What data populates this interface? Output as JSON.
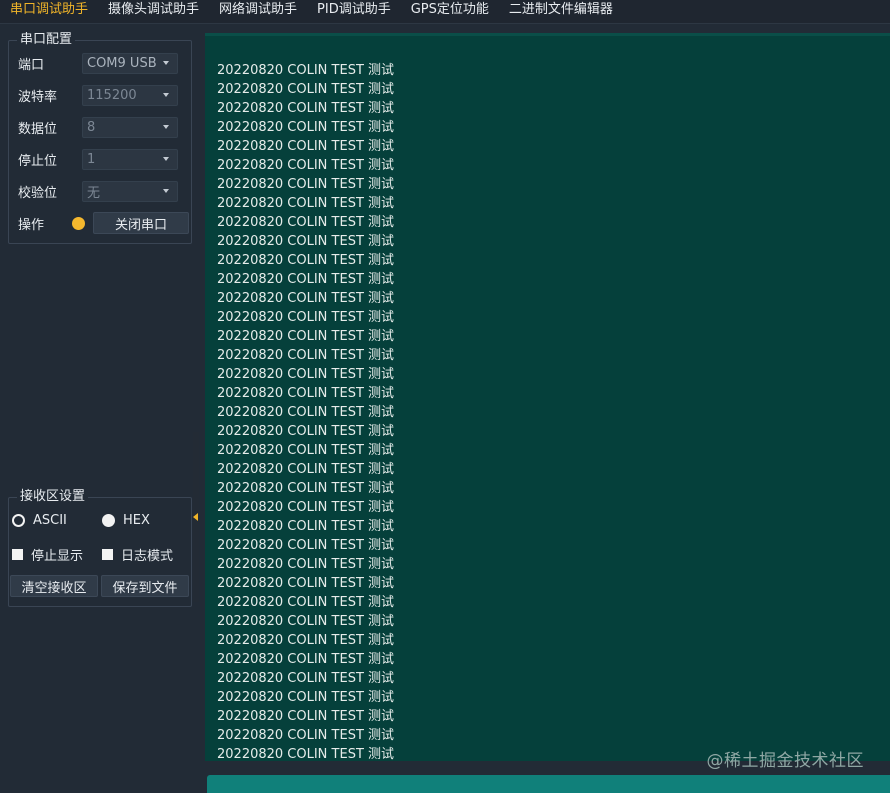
{
  "tabs": [
    {
      "label": "串口调试助手",
      "active": true
    },
    {
      "label": "摄像头调试助手",
      "active": false
    },
    {
      "label": "网络调试助手",
      "active": false
    },
    {
      "label": "PID调试助手",
      "active": false
    },
    {
      "label": "GPS定位功能",
      "active": false
    },
    {
      "label": "二进制文件编辑器",
      "active": false
    }
  ],
  "serial_config": {
    "title": "串口配置",
    "port": {
      "label": "端口",
      "value": "COM9 USB"
    },
    "baud": {
      "label": "波特率",
      "value": "115200"
    },
    "databits": {
      "label": "数据位",
      "value": "8"
    },
    "stopbits": {
      "label": "停止位",
      "value": "1"
    },
    "parity": {
      "label": "校验位",
      "value": "无"
    },
    "operation": {
      "label": "操作",
      "button": "关闭串口",
      "status_color": "#f5b82e"
    }
  },
  "recv_settings": {
    "title": "接收区设置",
    "ascii": "ASCII",
    "hex": "HEX",
    "pause": "停止显示",
    "log": "日志模式",
    "clear_button": "清空接收区",
    "save_button": "保存到文件"
  },
  "received_lines": [
    "20220820 COLIN TEST 测试",
    "20220820 COLIN TEST 测试",
    "20220820 COLIN TEST 测试",
    "20220820 COLIN TEST 测试",
    "20220820 COLIN TEST 测试",
    "20220820 COLIN TEST 测试",
    "20220820 COLIN TEST 测试",
    "20220820 COLIN TEST 测试",
    "20220820 COLIN TEST 测试",
    "20220820 COLIN TEST 测试",
    "20220820 COLIN TEST 测试",
    "20220820 COLIN TEST 测试",
    "20220820 COLIN TEST 测试",
    "20220820 COLIN TEST 测试",
    "20220820 COLIN TEST 测试",
    "20220820 COLIN TEST 测试",
    "20220820 COLIN TEST 测试",
    "20220820 COLIN TEST 测试",
    "20220820 COLIN TEST 测试",
    "20220820 COLIN TEST 测试",
    "20220820 COLIN TEST 测试",
    "20220820 COLIN TEST 测试",
    "20220820 COLIN TEST 测试",
    "20220820 COLIN TEST 测试",
    "20220820 COLIN TEST 测试",
    "20220820 COLIN TEST 测试",
    "20220820 COLIN TEST 测试",
    "20220820 COLIN TEST 测试",
    "20220820 COLIN TEST 测试",
    "20220820 COLIN TEST 测试",
    "20220820 COLIN TEST 测试",
    "20220820 COLIN TEST 测试",
    "20220820 COLIN TEST 测试",
    "20220820 COLIN TEST 测试",
    "20220820 COLIN TEST 测试",
    "20220820 COLIN TEST 测试",
    "20220820 COLIN TEST 测试",
    "20220820 COLIN TEST 测试"
  ],
  "watermark": "@稀土掘金技术社区",
  "colors": {
    "accent": "#f0b429",
    "recv_bg": "#05403b",
    "send_bg": "#10807a"
  }
}
